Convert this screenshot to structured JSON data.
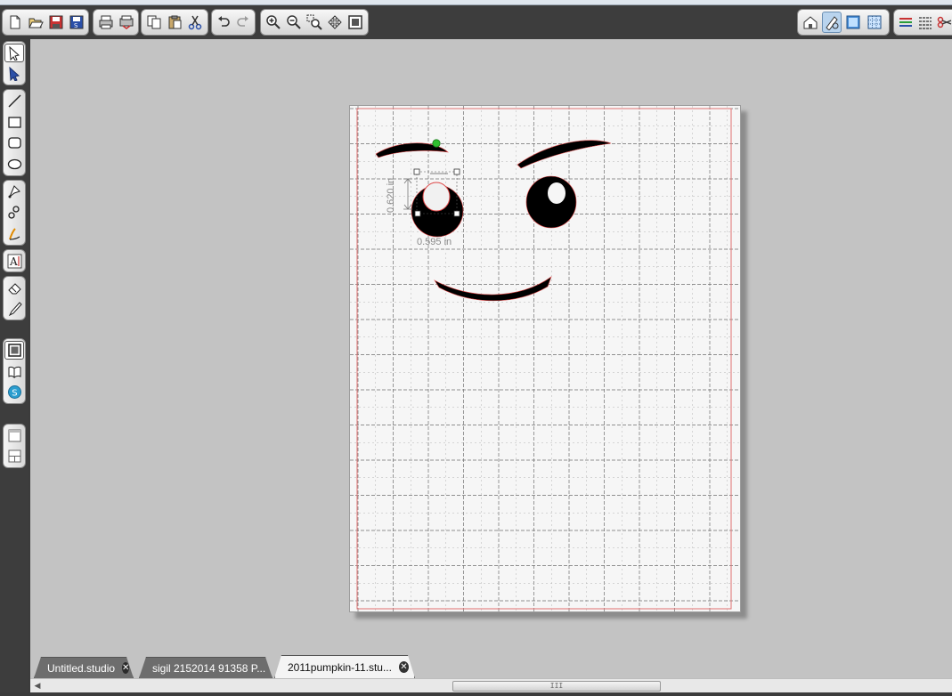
{
  "toolbar": {
    "file_tools": [
      "new-document-icon",
      "open-folder-icon",
      "save-icon",
      "save-to-library-icon"
    ],
    "print_tools": [
      "print-icon",
      "print-cut-icon"
    ],
    "clipboard_tools": [
      "copy-icon",
      "paste-icon",
      "cut-icon"
    ],
    "history_tools": [
      "undo-icon",
      "redo-icon"
    ],
    "zoom_tools": [
      "zoom-in-icon",
      "zoom-out-icon",
      "zoom-selection-icon",
      "pan-icon",
      "fit-to-page-icon"
    ],
    "right_tools": [
      "home-icon",
      "cut-settings-icon",
      "page-view-icon",
      "grid-icon",
      "line-style-icon",
      "align-icon",
      "scissors-icon"
    ]
  },
  "left_tools": {
    "select": [
      "select-arrow-icon",
      "edit-points-icon"
    ],
    "draw": [
      "line-tool-icon",
      "rectangle-tool-icon",
      "rounded-rectangle-tool-icon",
      "ellipse-tool-icon"
    ],
    "path": [
      "polygon-tool-icon",
      "curve-tool-icon",
      "freehand-tool-icon"
    ],
    "text": [
      "text-tool-icon"
    ],
    "edit": [
      "eraser-tool-icon",
      "knife-tool-icon"
    ],
    "library": [
      "page-setup-icon",
      "library-book-icon",
      "silhouette-store-icon"
    ],
    "panels": [
      "single-panel-icon",
      "split-panel-icon"
    ]
  },
  "canvas": {
    "selection": {
      "height_label": "0.620 in",
      "width_label": "0.595 in"
    }
  },
  "tabs": [
    {
      "label": "Untitled.studio",
      "active": false
    },
    {
      "label": "sigil 2152014 91358 P...",
      "active": false
    },
    {
      "label": "2011pumpkin-11.stu...",
      "active": true
    }
  ],
  "scrollbar": {
    "thumb_grip": "III"
  },
  "colors": {
    "toolbar_bg": "#3d3d3d",
    "workspace_bg": "#c3c3c3",
    "page_bg": "#f6f6f6",
    "cut_line": "#e04848",
    "shape_fill": "#000000",
    "rotation_handle": "#22bb22"
  }
}
